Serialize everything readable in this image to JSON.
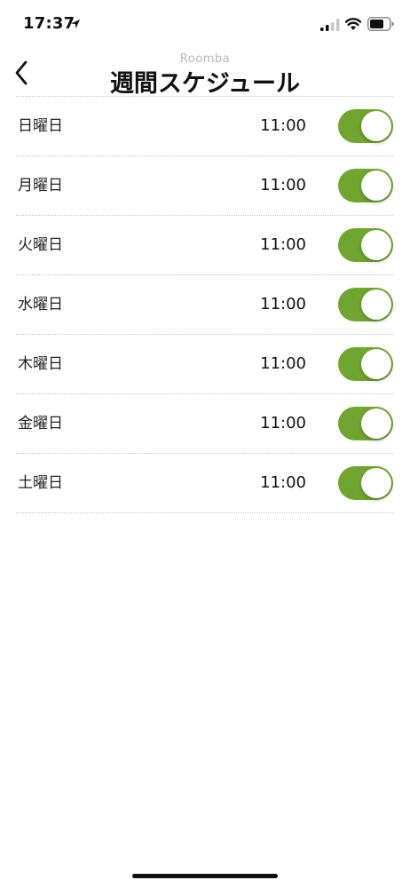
{
  "status_bar": {
    "time": "17:37"
  },
  "nav": {
    "subtitle": "Roomba",
    "title": "週間スケジュール"
  },
  "schedule": [
    {
      "day": "日曜日",
      "time": "11:00",
      "enabled": true
    },
    {
      "day": "月曜日",
      "time": "11:00",
      "enabled": true
    },
    {
      "day": "火曜日",
      "time": "11:00",
      "enabled": true
    },
    {
      "day": "水曜日",
      "time": "11:00",
      "enabled": true
    },
    {
      "day": "木曜日",
      "time": "11:00",
      "enabled": true
    },
    {
      "day": "金曜日",
      "time": "11:00",
      "enabled": true
    },
    {
      "day": "土曜日",
      "time": "11:00",
      "enabled": true
    }
  ],
  "colors": {
    "toggle_on": "#70a532",
    "divider": "#c4c4c4"
  }
}
